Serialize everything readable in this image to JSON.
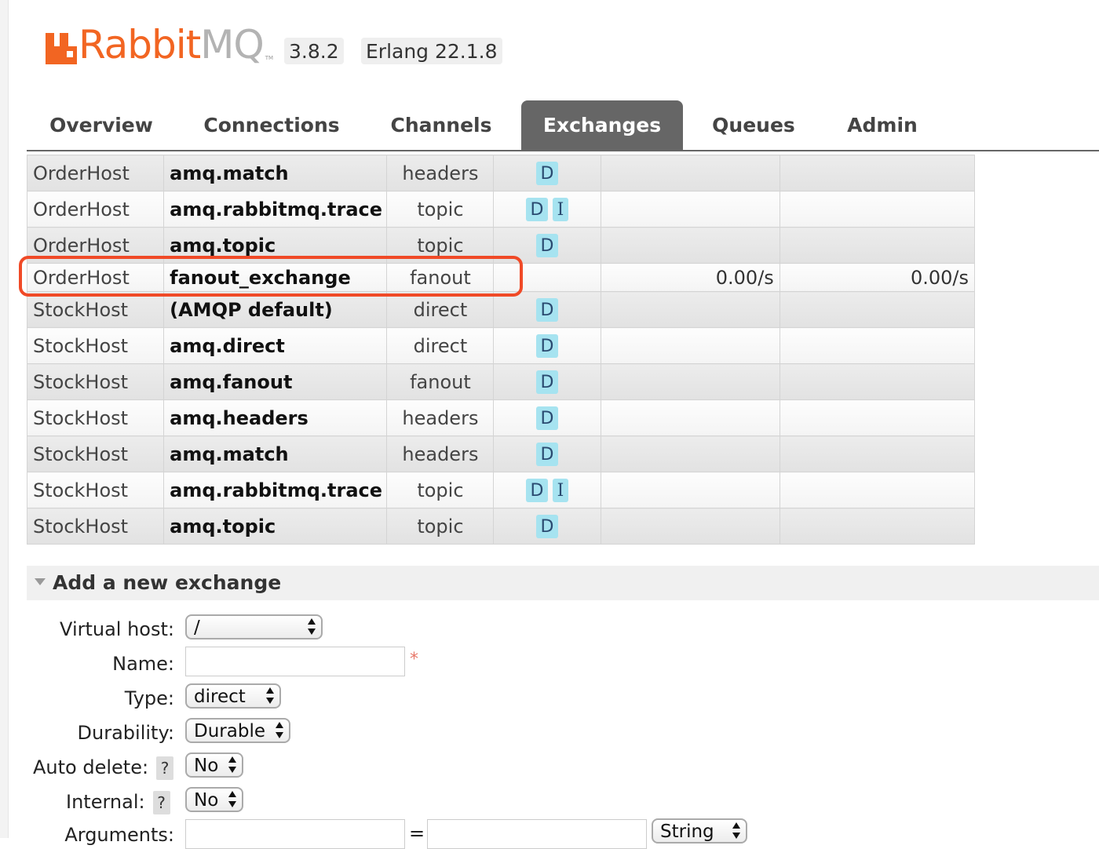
{
  "header": {
    "logo_rabbit": "Rabbit",
    "logo_mq": "MQ",
    "logo_tm": "TM",
    "version": "3.8.2",
    "erlang": "Erlang 22.1.8"
  },
  "nav": {
    "tabs": [
      {
        "label": "Overview"
      },
      {
        "label": "Connections"
      },
      {
        "label": "Channels"
      },
      {
        "label": "Exchanges"
      },
      {
        "label": "Queues"
      },
      {
        "label": "Admin"
      }
    ],
    "active": "Exchanges"
  },
  "exchanges": {
    "rows": [
      {
        "vhost": "OrderHost",
        "name": "amq.match",
        "type": "headers",
        "features": [
          "D"
        ],
        "rate_in": "",
        "rate_out": ""
      },
      {
        "vhost": "OrderHost",
        "name": "amq.rabbitmq.trace",
        "type": "topic",
        "features": [
          "D",
          "I"
        ],
        "rate_in": "",
        "rate_out": ""
      },
      {
        "vhost": "OrderHost",
        "name": "amq.topic",
        "type": "topic",
        "features": [
          "D"
        ],
        "rate_in": "",
        "rate_out": ""
      },
      {
        "vhost": "OrderHost",
        "name": "fanout_exchange",
        "type": "fanout",
        "features": [],
        "rate_in": "0.00/s",
        "rate_out": "0.00/s"
      },
      {
        "vhost": "StockHost",
        "name": "(AMQP default)",
        "type": "direct",
        "features": [
          "D"
        ],
        "rate_in": "",
        "rate_out": ""
      },
      {
        "vhost": "StockHost",
        "name": "amq.direct",
        "type": "direct",
        "features": [
          "D"
        ],
        "rate_in": "",
        "rate_out": ""
      },
      {
        "vhost": "StockHost",
        "name": "amq.fanout",
        "type": "fanout",
        "features": [
          "D"
        ],
        "rate_in": "",
        "rate_out": ""
      },
      {
        "vhost": "StockHost",
        "name": "amq.headers",
        "type": "headers",
        "features": [
          "D"
        ],
        "rate_in": "",
        "rate_out": ""
      },
      {
        "vhost": "StockHost",
        "name": "amq.match",
        "type": "headers",
        "features": [
          "D"
        ],
        "rate_in": "",
        "rate_out": ""
      },
      {
        "vhost": "StockHost",
        "name": "amq.rabbitmq.trace",
        "type": "topic",
        "features": [
          "D",
          "I"
        ],
        "rate_in": "",
        "rate_out": ""
      },
      {
        "vhost": "StockHost",
        "name": "amq.topic",
        "type": "topic",
        "features": [
          "D"
        ],
        "rate_in": "",
        "rate_out": ""
      }
    ],
    "highlight_color": "#f04a27",
    "feature_badge_color": "#a6e3f0"
  },
  "add_exchange": {
    "title": "Add a new exchange",
    "labels": {
      "virtual_host": "Virtual host:",
      "name": "Name:",
      "type": "Type:",
      "durability": "Durability:",
      "auto_delete": "Auto delete:",
      "internal": "Internal:",
      "arguments": "Arguments:"
    },
    "help": "?",
    "required_mark": "*",
    "equals": "=",
    "values": {
      "virtual_host": "/",
      "name": "",
      "type": "direct",
      "durability": "Durable",
      "auto_delete": "No",
      "internal": "No",
      "arg_key": "",
      "arg_value": "",
      "arg_type": "String"
    }
  },
  "colors": {
    "brand": "#f26522",
    "tab_active_bg": "#666666"
  }
}
